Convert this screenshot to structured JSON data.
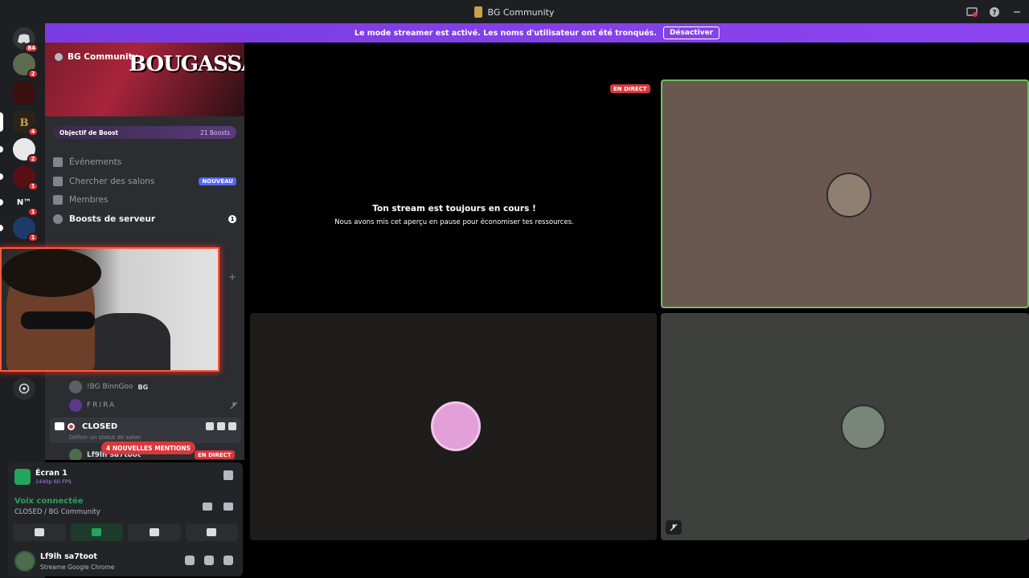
{
  "window": {
    "title": "BG Community"
  },
  "banner": {
    "message": "Le mode streamer est activé. Les noms d'utilisateur ont été tronqués.",
    "button_label": "Désactiver"
  },
  "server_list": {
    "badges": [
      "84",
      "2",
      "4",
      "2",
      "1",
      "1",
      "1"
    ],
    "label_nx": "N™"
  },
  "sidebar": {
    "server_name": "BG Community",
    "banner_text": "BOUGASSAA",
    "boost": {
      "label": "Objectif de Boost",
      "count": "21 Boosts"
    },
    "items": [
      {
        "label": "Événements"
      },
      {
        "label": "Chercher des salons",
        "badge": "NOUVEAU"
      },
      {
        "label": "Membres"
      },
      {
        "label": "Boosts de serveur",
        "count": "1"
      }
    ],
    "members": [
      {
        "name": "!BG BinnGoo",
        "tag": "BG"
      },
      {
        "name": "FRIRA"
      }
    ],
    "voice_channel": {
      "name": "CLOSED",
      "status_placeholder": "Définir un statut de salon"
    },
    "channel_member": "Lf9lh sa7toot",
    "mentions_label": "4 NOUVELLES MENTIONS",
    "live_label": "EN DIRECT"
  },
  "user_panel": {
    "screen_title": "Écran 1",
    "screen_quality": "1440p 60 FPS",
    "voice_status": "Voix connectée",
    "voice_channel": "CLOSED / BG Community",
    "username": "Lf9lh sa7toot",
    "activity": "Streame Google Chrome"
  },
  "stage": {
    "live_label": "EN DIRECT",
    "paused_title": "Ton stream est toujours en cours !",
    "paused_text": "Nous avons mis cet aperçu en pause pour économiser tes ressources."
  },
  "colors": {
    "accent": "#5865f2",
    "streamer_banner": "#7c3aed",
    "live_red": "#da373c",
    "voice_green": "#23a55a",
    "speaking_border": "#6dbf5d"
  }
}
